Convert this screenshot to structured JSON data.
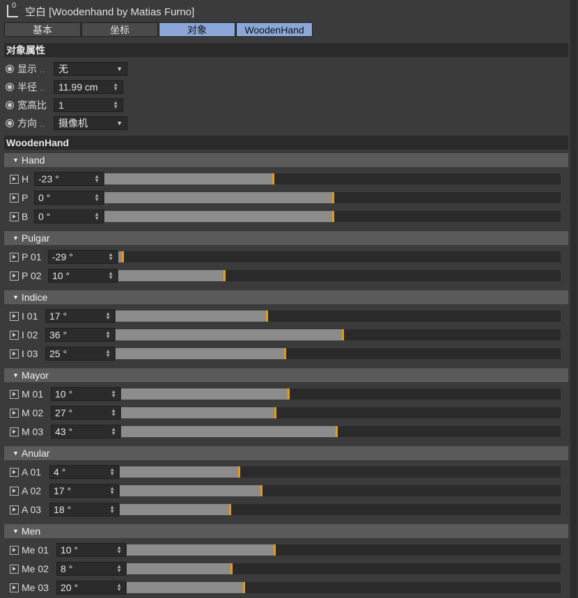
{
  "window": {
    "title": "空白 [Woodenhand by Matias Furno]",
    "logo_text": "0"
  },
  "tabs": [
    {
      "label": "基本",
      "active": false
    },
    {
      "label": "坐标",
      "active": false
    },
    {
      "label": "对象",
      "active": true
    },
    {
      "label": "WoodenHand",
      "active": true
    }
  ],
  "object_props": {
    "title": "对象属性",
    "rows": [
      {
        "label": "显示",
        "dots": "..",
        "value": "无",
        "kind": "dropdown"
      },
      {
        "label": "半径",
        "dots": "..",
        "value": "11.99 cm",
        "kind": "number"
      },
      {
        "label": "宽高比",
        "dots": "",
        "value": "1",
        "kind": "number"
      },
      {
        "label": "方向",
        "dots": "..",
        "value": "摄像机",
        "kind": "dropdown"
      }
    ]
  },
  "wh_section": {
    "title": "WoodenHand"
  },
  "groups": [
    {
      "name": "Hand",
      "rows": [
        {
          "label": "H",
          "value": "-23 °",
          "fraction": 0.37
        },
        {
          "label": "P",
          "value": "0 °",
          "fraction": 0.5
        },
        {
          "label": "B",
          "value": "0 °",
          "fraction": 0.5
        }
      ]
    },
    {
      "name": "Pulgar",
      "rows": [
        {
          "label": "P 01",
          "value": "-29 °",
          "fraction": 0.01
        },
        {
          "label": "P 02",
          "value": "10 °",
          "fraction": 0.24
        }
      ]
    },
    {
      "name": "Indice",
      "rows": [
        {
          "label": "I 01",
          "value": "17 °",
          "fraction": 0.34
        },
        {
          "label": "I 02",
          "value": "36 °",
          "fraction": 0.51
        },
        {
          "label": "I 03",
          "value": "25 °",
          "fraction": 0.38
        }
      ]
    },
    {
      "name": "Mayor",
      "rows": [
        {
          "label": "M 01",
          "value": "10 °",
          "fraction": 0.38
        },
        {
          "label": "M 02",
          "value": "27 °",
          "fraction": 0.35
        },
        {
          "label": "M 03",
          "value": "43 °",
          "fraction": 0.49
        }
      ]
    },
    {
      "name": "Anular",
      "rows": [
        {
          "label": "A 01",
          "value": "4 °",
          "fraction": 0.27
        },
        {
          "label": "A 02",
          "value": "17 °",
          "fraction": 0.32
        },
        {
          "label": "A 03",
          "value": "18 °",
          "fraction": 0.25
        }
      ]
    },
    {
      "name": "Men",
      "rows": [
        {
          "label": "Me 01",
          "value": "10 °",
          "fraction": 0.34
        },
        {
          "label": "Me 02",
          "value": "8 °",
          "fraction": 0.24
        },
        {
          "label": "Me 03",
          "value": "20 °",
          "fraction": 0.27
        }
      ]
    }
  ],
  "colors": {
    "accent": "#8aa7d8",
    "knob": "#e39a16",
    "fill": "#8c8c8c"
  }
}
